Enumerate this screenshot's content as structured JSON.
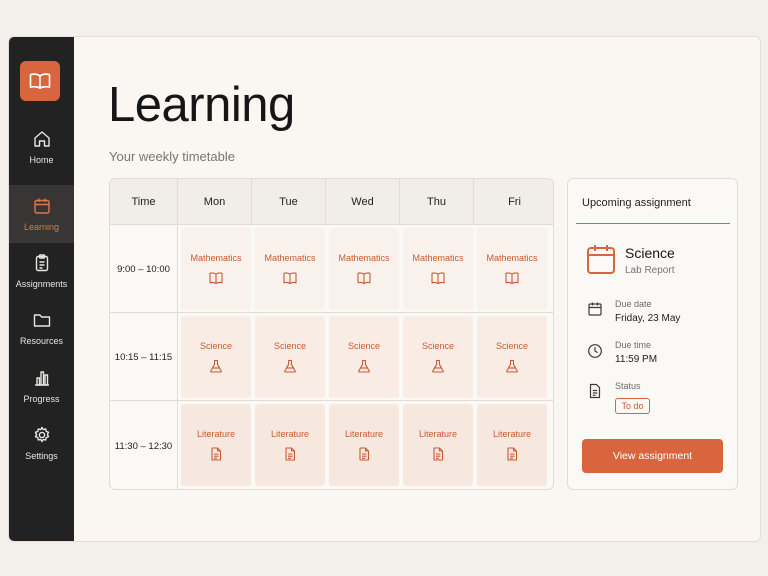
{
  "sidebar": {
    "items": [
      {
        "label": "Home",
        "icon": "home-icon"
      },
      {
        "label": "Learning",
        "icon": "calendar-icon",
        "active": true
      },
      {
        "label": "Assignments",
        "icon": "clipboard-icon"
      },
      {
        "label": "Resources",
        "icon": "folder-icon"
      },
      {
        "label": "Progress",
        "icon": "bar-chart-icon"
      },
      {
        "label": "Settings",
        "icon": "gear-icon"
      }
    ]
  },
  "page": {
    "title": "Learning",
    "subtitle": "Your weekly timetable"
  },
  "timetable": {
    "time_header": "Time",
    "days": [
      "Mon",
      "Tue",
      "Wed",
      "Thu",
      "Fri"
    ],
    "rows": [
      {
        "time": "9:00 – 10:00",
        "subject": "Mathematics",
        "icon": "book-icon"
      },
      {
        "time": "10:15 – 11:15",
        "subject": "Science",
        "icon": "flask-icon"
      },
      {
        "time": "11:30 – 12:30",
        "subject": "Literature",
        "icon": "document-icon"
      }
    ]
  },
  "assignment": {
    "heading": "Upcoming assignment",
    "subject": "Science",
    "type": "Lab Report",
    "due_date_label": "Due date",
    "due_date": "Friday, 23 May",
    "due_time_label": "Due time",
    "due_time": "11:59 PM",
    "status_label": "Status",
    "status": "To do",
    "button": "View assignment"
  },
  "colors": {
    "accent": "#d9653f",
    "sidebar_bg": "#222222",
    "page_bg": "#faf7f3"
  }
}
